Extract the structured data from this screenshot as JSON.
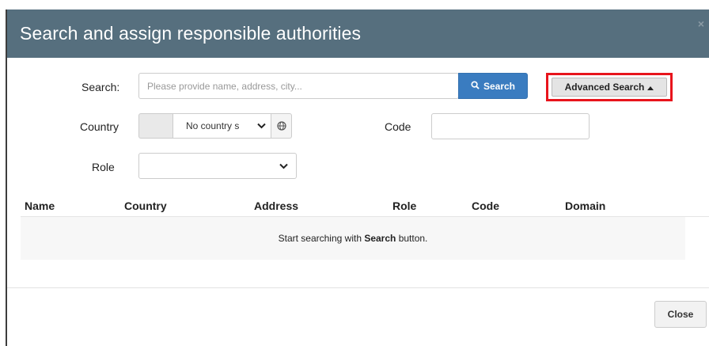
{
  "modal": {
    "title": "Search and assign responsible authorities",
    "close_glyph": "×"
  },
  "search": {
    "label": "Search:",
    "placeholder": "Please provide name, address, city...",
    "button_label": "Search",
    "advanced_label": "Advanced Search"
  },
  "filters": {
    "country_label": "Country",
    "country_selected": "No country s",
    "code_label": "Code",
    "code_value": "",
    "role_label": "Role",
    "role_selected": ""
  },
  "table": {
    "headers": [
      "Name",
      "Country",
      "Address",
      "Role",
      "Code",
      "Domain"
    ],
    "empty_prefix": "Start searching with ",
    "empty_bold": "Search",
    "empty_suffix": " button."
  },
  "footer": {
    "close_label": "Close"
  },
  "colors": {
    "header_bg": "#566f7e",
    "primary": "#3a7cc0",
    "highlight": "#e8141c"
  },
  "icons": [
    "search-icon",
    "caret-up-icon",
    "chevron-down-icon",
    "globe-icon",
    "close-icon"
  ]
}
